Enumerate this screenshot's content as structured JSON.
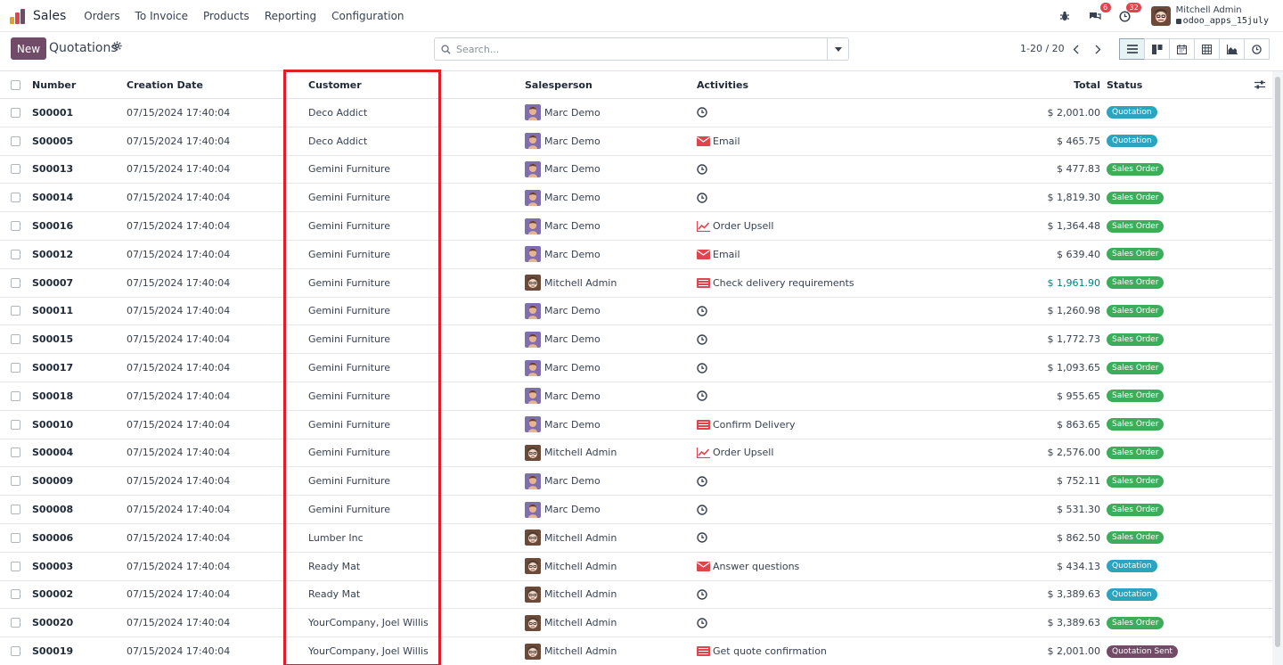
{
  "nav": {
    "app_name": "Sales",
    "menu": [
      "Orders",
      "To Invoice",
      "Products",
      "Reporting",
      "Configuration"
    ],
    "chat_badge": "6",
    "activity_badge": "32",
    "user_name": "Mitchell Admin",
    "database": "odoo_apps_15july"
  },
  "control": {
    "new_label": "New",
    "title": "Quotations",
    "search_placeholder": "Search...",
    "pager": "1-20 / 20"
  },
  "colors": {
    "brand": "#714b67",
    "quotation": "#2aa4bf",
    "sales_order": "#3cae5b",
    "quotation_sent": "#714b67",
    "highlight": "#e11d2a"
  },
  "table": {
    "headers": {
      "number": "Number",
      "date": "Creation Date",
      "customer": "Customer",
      "salesperson": "Salesperson",
      "activities": "Activities",
      "total": "Total",
      "status": "Status"
    },
    "rows": [
      {
        "number": "S00001",
        "date": "07/15/2024 17:40:04",
        "customer": "Deco Addict",
        "salesperson": "Marc Demo",
        "activity": "",
        "activity_icon": "clock-icon",
        "total": "$ 2,001.00",
        "status": "Quotation",
        "status_type": "quotation"
      },
      {
        "number": "S00005",
        "date": "07/15/2024 17:40:04",
        "customer": "Deco Addict",
        "salesperson": "Marc Demo",
        "activity": "Email",
        "activity_icon": "email-icon",
        "total": "$ 465.75",
        "status": "Quotation",
        "status_type": "quotation"
      },
      {
        "number": "S00013",
        "date": "07/15/2024 17:40:04",
        "customer": "Gemini Furniture",
        "salesperson": "Marc Demo",
        "activity": "",
        "activity_icon": "clock-icon",
        "total": "$ 477.83",
        "status": "Sales Order",
        "status_type": "sales_order"
      },
      {
        "number": "S00014",
        "date": "07/15/2024 17:40:04",
        "customer": "Gemini Furniture",
        "salesperson": "Marc Demo",
        "activity": "",
        "activity_icon": "clock-icon",
        "total": "$ 1,819.30",
        "status": "Sales Order",
        "status_type": "sales_order"
      },
      {
        "number": "S00016",
        "date": "07/15/2024 17:40:04",
        "customer": "Gemini Furniture",
        "salesperson": "Marc Demo",
        "activity": "Order Upsell",
        "activity_icon": "upsell-icon",
        "total": "$ 1,364.48",
        "status": "Sales Order",
        "status_type": "sales_order"
      },
      {
        "number": "S00012",
        "date": "07/15/2024 17:40:04",
        "customer": "Gemini Furniture",
        "salesperson": "Marc Demo",
        "activity": "Email",
        "activity_icon": "email-icon",
        "total": "$ 639.40",
        "status": "Sales Order",
        "status_type": "sales_order"
      },
      {
        "number": "S00007",
        "date": "07/15/2024 17:40:04",
        "customer": "Gemini Furniture",
        "salesperson": "Mitchell Admin",
        "activity": "Check delivery requirements",
        "activity_icon": "todo-icon",
        "total": "$ 1,961.90",
        "status": "Sales Order",
        "status_type": "sales_order",
        "total_link": true
      },
      {
        "number": "S00011",
        "date": "07/15/2024 17:40:04",
        "customer": "Gemini Furniture",
        "salesperson": "Marc Demo",
        "activity": "",
        "activity_icon": "clock-icon",
        "total": "$ 1,260.98",
        "status": "Sales Order",
        "status_type": "sales_order"
      },
      {
        "number": "S00015",
        "date": "07/15/2024 17:40:04",
        "customer": "Gemini Furniture",
        "salesperson": "Marc Demo",
        "activity": "",
        "activity_icon": "clock-icon",
        "total": "$ 1,772.73",
        "status": "Sales Order",
        "status_type": "sales_order"
      },
      {
        "number": "S00017",
        "date": "07/15/2024 17:40:04",
        "customer": "Gemini Furniture",
        "salesperson": "Marc Demo",
        "activity": "",
        "activity_icon": "clock-icon",
        "total": "$ 1,093.65",
        "status": "Sales Order",
        "status_type": "sales_order"
      },
      {
        "number": "S00018",
        "date": "07/15/2024 17:40:04",
        "customer": "Gemini Furniture",
        "salesperson": "Marc Demo",
        "activity": "",
        "activity_icon": "clock-icon",
        "total": "$ 955.65",
        "status": "Sales Order",
        "status_type": "sales_order"
      },
      {
        "number": "S00010",
        "date": "07/15/2024 17:40:04",
        "customer": "Gemini Furniture",
        "salesperson": "Marc Demo",
        "activity": "Confirm Delivery",
        "activity_icon": "todo-icon",
        "total": "$ 863.65",
        "status": "Sales Order",
        "status_type": "sales_order"
      },
      {
        "number": "S00004",
        "date": "07/15/2024 17:40:04",
        "customer": "Gemini Furniture",
        "salesperson": "Mitchell Admin",
        "activity": "Order Upsell",
        "activity_icon": "upsell-icon",
        "total": "$ 2,576.00",
        "status": "Sales Order",
        "status_type": "sales_order"
      },
      {
        "number": "S00009",
        "date": "07/15/2024 17:40:04",
        "customer": "Gemini Furniture",
        "salesperson": "Marc Demo",
        "activity": "",
        "activity_icon": "clock-icon",
        "total": "$ 752.11",
        "status": "Sales Order",
        "status_type": "sales_order"
      },
      {
        "number": "S00008",
        "date": "07/15/2024 17:40:04",
        "customer": "Gemini Furniture",
        "salesperson": "Marc Demo",
        "activity": "",
        "activity_icon": "clock-icon",
        "total": "$ 531.30",
        "status": "Sales Order",
        "status_type": "sales_order"
      },
      {
        "number": "S00006",
        "date": "07/15/2024 17:40:04",
        "customer": "Lumber Inc",
        "salesperson": "Mitchell Admin",
        "activity": "",
        "activity_icon": "clock-icon",
        "total": "$ 862.50",
        "status": "Sales Order",
        "status_type": "sales_order"
      },
      {
        "number": "S00003",
        "date": "07/15/2024 17:40:04",
        "customer": "Ready Mat",
        "salesperson": "Mitchell Admin",
        "activity": "Answer questions",
        "activity_icon": "email-icon",
        "total": "$ 434.13",
        "status": "Quotation",
        "status_type": "quotation"
      },
      {
        "number": "S00002",
        "date": "07/15/2024 17:40:04",
        "customer": "Ready Mat",
        "salesperson": "Mitchell Admin",
        "activity": "",
        "activity_icon": "clock-icon",
        "total": "$ 3,389.63",
        "status": "Quotation",
        "status_type": "quotation"
      },
      {
        "number": "S00020",
        "date": "07/15/2024 17:40:04",
        "customer": "YourCompany, Joel Willis",
        "salesperson": "Mitchell Admin",
        "activity": "",
        "activity_icon": "clock-icon",
        "total": "$ 3,389.63",
        "status": "Sales Order",
        "status_type": "sales_order"
      },
      {
        "number": "S00019",
        "date": "07/15/2024 17:40:04",
        "customer": "YourCompany, Joel Willis",
        "salesperson": "Mitchell Admin",
        "activity": "Get quote confirmation",
        "activity_icon": "todo-icon",
        "total": "$ 2,001.00",
        "status": "Quotation Sent",
        "status_type": "quotation_sent"
      }
    ]
  }
}
